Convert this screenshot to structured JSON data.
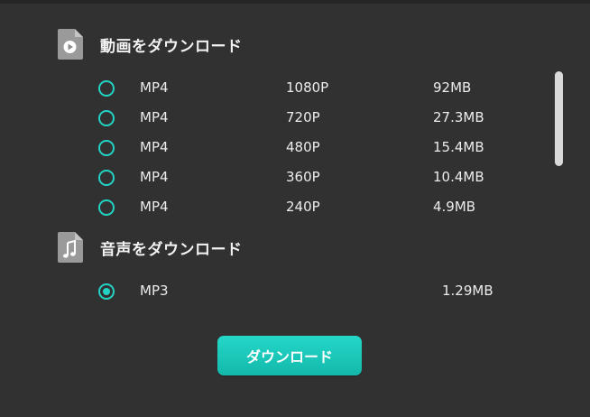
{
  "colors": {
    "background": "#313131",
    "accent": "#22d3c5",
    "text": "#ececec",
    "icon": "#9a9a9a",
    "scrollbar": "#d9d9d9"
  },
  "video_section": {
    "title": "動画をダウンロード",
    "icon": "video-file-icon",
    "options": [
      {
        "format": "MP4",
        "resolution": "1080P",
        "size": "92MB",
        "selected": false
      },
      {
        "format": "MP4",
        "resolution": "720P",
        "size": "27.3MB",
        "selected": false
      },
      {
        "format": "MP4",
        "resolution": "480P",
        "size": "15.4MB",
        "selected": false
      },
      {
        "format": "MP4",
        "resolution": "360P",
        "size": "10.4MB",
        "selected": false
      },
      {
        "format": "MP4",
        "resolution": "240P",
        "size": "4.9MB",
        "selected": false
      }
    ]
  },
  "audio_section": {
    "title": "音声をダウンロード",
    "icon": "audio-file-icon",
    "options": [
      {
        "format": "MP3",
        "size": "1.29MB",
        "selected": true
      }
    ]
  },
  "download_button": {
    "label": "ダウンロード"
  }
}
